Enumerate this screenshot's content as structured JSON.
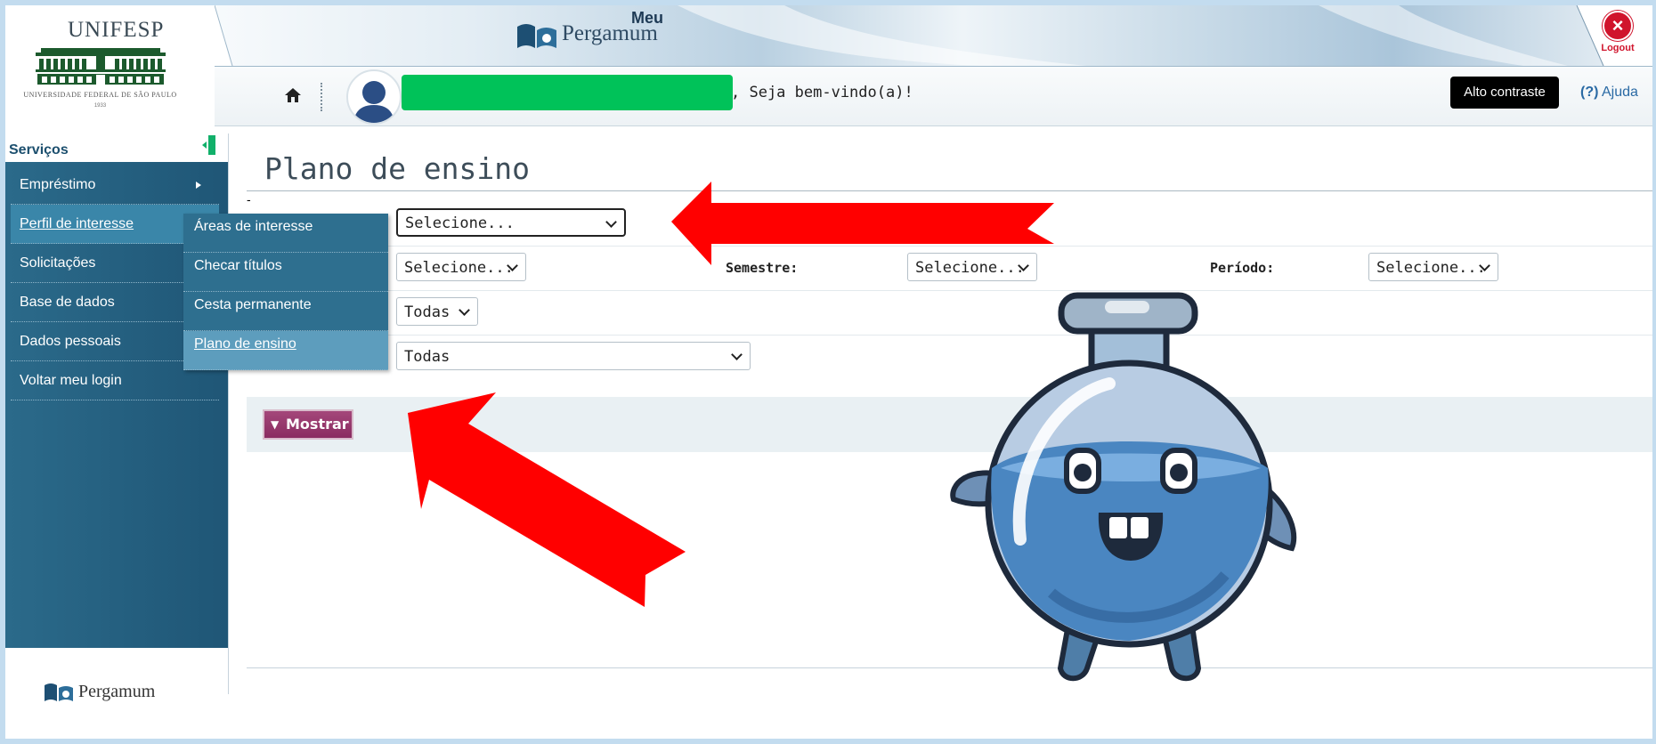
{
  "header": {
    "logo_title": "UNIFESP",
    "logo_subtitle": "UNIVERSIDADE FEDERAL DE SÃO PAULO",
    "logo_year": "1933",
    "brand_meu": "Meu",
    "brand_name": "Pergamum",
    "logout_label": "Logout",
    "welcome_text": ", Seja bem-vindo(a)!",
    "contrast_label": "Alto contraste",
    "help_prefix": "(?)",
    "help_label": "Ajuda"
  },
  "sidebar": {
    "title": "Serviços",
    "items": [
      {
        "label": "Empréstimo"
      },
      {
        "label": "Perfil de interesse"
      },
      {
        "label": "Solicitações"
      },
      {
        "label": "Base de dados"
      },
      {
        "label": "Dados pessoais"
      },
      {
        "label": "Voltar meu login"
      }
    ],
    "submenu": [
      {
        "label": "Áreas de interesse"
      },
      {
        "label": "Checar títulos"
      },
      {
        "label": "Cesta permanente"
      },
      {
        "label": "Plano de ensino"
      }
    ],
    "footer_brand": "Pergamum"
  },
  "main": {
    "title": "Plano de ensino",
    "dash": "-",
    "row1": {
      "select_value": "Selecione..."
    },
    "row2": {
      "select1_value": "Selecione...",
      "semestre_label": "Semestre:",
      "select2_value": "Selecione...",
      "periodo_label": "Período:",
      "select3_value": "Selecione..."
    },
    "row3": {
      "select_value": "Todas"
    },
    "row4": {
      "select_value": "Todas"
    },
    "submit_label": "Mostrar"
  },
  "colors": {
    "sidebar_bg": "#2b6a8a",
    "arrow": "#ff0000",
    "submit_bg": "#9a3a6f",
    "name_mask": "#00c259"
  }
}
